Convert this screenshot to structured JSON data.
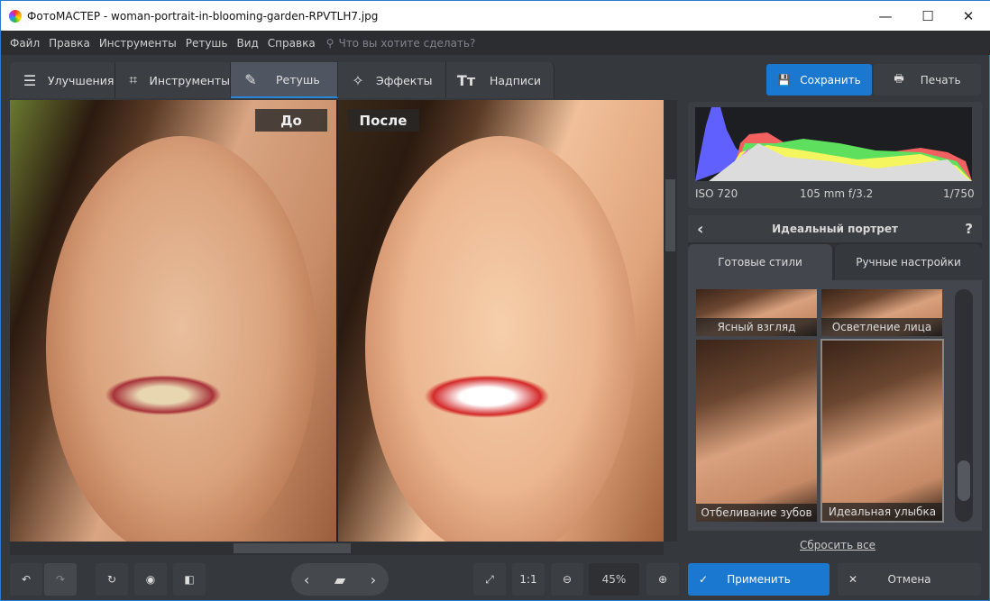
{
  "window": {
    "title": "ФотоМАСТЕР - woman-portrait-in-blooming-garden-RPVTLH7.jpg",
    "minimize": "—",
    "maximize": "☐",
    "close": "✕"
  },
  "menu": [
    "Файл",
    "Правка",
    "Инструменты",
    "Ретушь",
    "Вид",
    "Справка"
  ],
  "search_placeholder": "Что вы хотите сделать?",
  "tabs": [
    {
      "label": "Улучшения"
    },
    {
      "label": "Инструменты"
    },
    {
      "label": "Ретушь"
    },
    {
      "label": "Эффекты"
    },
    {
      "label": "Надписи"
    }
  ],
  "active_tab": "Ретушь",
  "save_label": "Сохранить",
  "print_label": "Печать",
  "before_label": "До",
  "after_label": "После",
  "histogram": {
    "iso": "ISO 720",
    "lens": "105 mm f/3.2",
    "shutter": "1/750"
  },
  "panel": {
    "title": "Идеальный портрет",
    "help": "?",
    "subtabs": [
      "Готовые стили",
      "Ручные настройки"
    ],
    "styles": [
      "Ясный взгляд",
      "Осветление лица",
      "Отбеливание зубов",
      "Идеальная улыбка"
    ],
    "reset": "Сбросить все"
  },
  "bottom": {
    "one_to_one": "1:1",
    "zoom": "45%",
    "apply": "Применить",
    "cancel": "Отмена"
  },
  "colors": {
    "accent": "#1a78d0"
  }
}
